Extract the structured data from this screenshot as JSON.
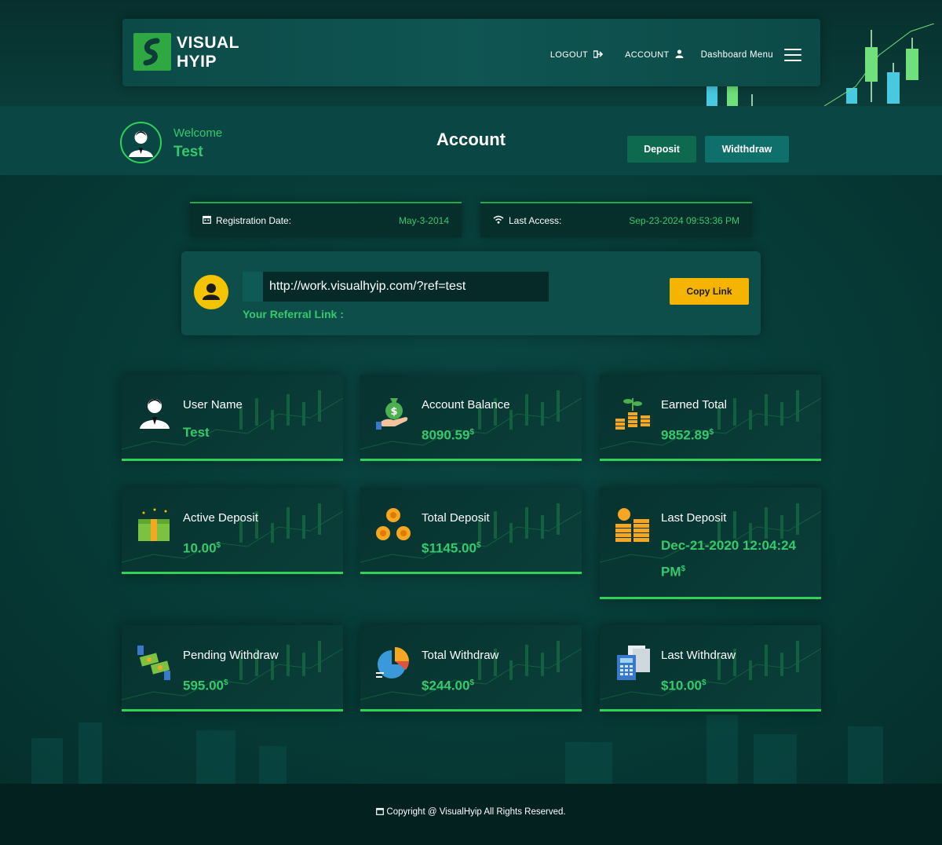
{
  "brand": {
    "name_line1": "VISUAL",
    "name_line2": "HYIP"
  },
  "nav": {
    "logout": "LOGOUT",
    "account": "ACCOUNT",
    "dashboard_menu": "Dashboard Menu"
  },
  "welcome": {
    "label": "Welcome",
    "name": "Test"
  },
  "page_title": "Account",
  "buttons": {
    "deposit": "Deposit",
    "withdraw": "Widthdraw",
    "copy_link": "Copy Link"
  },
  "info": {
    "registration_label": "Registration Date:",
    "registration_value": "May-3-2014",
    "last_access_label": "Last Access:",
    "last_access_value": "Sep-23-2024 09:53:36 PM"
  },
  "referral": {
    "url": "http://work.visualhyip.com/?ref=test",
    "label": "Your Referral Link :"
  },
  "cards": [
    {
      "label": "User Name",
      "value": "Test",
      "currency": "",
      "icon": "user-icon"
    },
    {
      "label": "Account Balance",
      "value": "8090.59",
      "currency": "$",
      "icon": "money-bag-hand-icon"
    },
    {
      "label": "Earned Total",
      "value": "9852.89",
      "currency": "$",
      "icon": "coin-plant-icon"
    },
    {
      "label": "Active Deposit",
      "value": "10.00",
      "currency": "$",
      "icon": "cash-stack-icon"
    },
    {
      "label": "Total Deposit",
      "value": "$1145.00",
      "currency": "$",
      "icon": "coins-cycle-icon"
    },
    {
      "label": "Last Deposit",
      "value": "Dec-21-2020 12:04:24 PM",
      "currency": "$",
      "icon": "coin-stacks-icon"
    },
    {
      "label": "Pending Withdraw",
      "value": "595.00",
      "currency": "$",
      "icon": "cash-exchange-icon"
    },
    {
      "label": "Total Withdraw",
      "value": "$244.00",
      "currency": "$",
      "icon": "pie-chart-icon"
    },
    {
      "label": "Last Withdraw",
      "value": "$10.00",
      "currency": "$",
      "icon": "calculator-document-icon"
    }
  ],
  "footer": {
    "copyright": "Copyright @ VisualHyip All Rights Reserved."
  },
  "colors": {
    "accent_green": "#36c96b",
    "button_yellow": "#f5b400",
    "background": "#063a36"
  }
}
